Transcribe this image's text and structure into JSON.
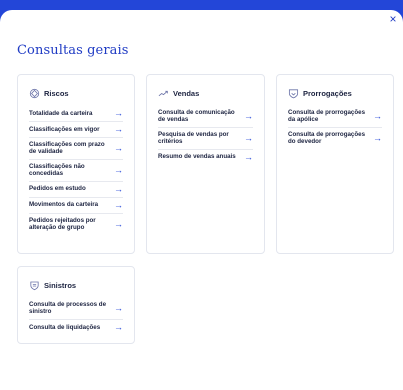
{
  "modal": {
    "close_label": "×",
    "title": "Consultas gerais"
  },
  "cards": {
    "riscos": {
      "title": "Riscos",
      "icon": "risk-diamond-icon",
      "items": [
        {
          "label": "Totalidade da carteira"
        },
        {
          "label": "Classificações em vigor"
        },
        {
          "label": "Classificações com prazo de validade"
        },
        {
          "label": "Classificações não concedidas"
        },
        {
          "label": "Pedidos em estudo"
        },
        {
          "label": "Movimentos da carteira"
        },
        {
          "label": "Pedidos rejeitados por alteração de grupo"
        }
      ]
    },
    "vendas": {
      "title": "Vendas",
      "icon": "sales-trend-icon",
      "items": [
        {
          "label": "Consulta de comunicação de vendas"
        },
        {
          "label": "Pesquisa de vendas por critérios"
        },
        {
          "label": "Resumo de vendas anuais"
        }
      ]
    },
    "prorrogacoes": {
      "title": "Prorrogações",
      "icon": "extension-shield-icon",
      "items": [
        {
          "label": "Consulta de prorrogações da apólice"
        },
        {
          "label": "Consulta de prorrogações do devedor"
        }
      ]
    },
    "sinistros": {
      "title": "Sinistros",
      "icon": "claims-shield-icon",
      "items": [
        {
          "label": "Consulta de processos de sinistro"
        },
        {
          "label": "Consulta de liquidações"
        }
      ]
    }
  },
  "arrow_glyph": "→",
  "colors": {
    "brand_blue": "#2346d8",
    "title_blue": "#1f3bc4",
    "text_dark": "#1c2340",
    "border": "#e3e6ee"
  }
}
